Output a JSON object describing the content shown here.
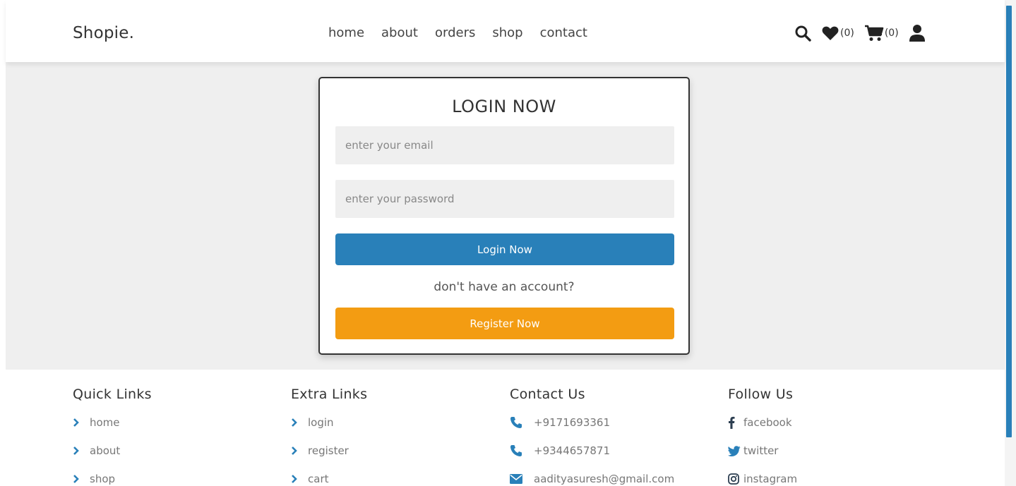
{
  "header": {
    "logo": "Shopie.",
    "nav": [
      {
        "label": "home"
      },
      {
        "label": "about"
      },
      {
        "label": "orders"
      },
      {
        "label": "shop"
      },
      {
        "label": "contact"
      }
    ],
    "wishlist_count": "(0)",
    "cart_count": "(0)"
  },
  "login_form": {
    "title": "LOGIN NOW",
    "email_placeholder": "enter your email",
    "password_placeholder": "enter your password",
    "login_button": "Login Now",
    "no_account_text": "don't have an account?",
    "register_button": "Register Now"
  },
  "footer": {
    "quick_links": {
      "title": "Quick Links",
      "items": [
        "home",
        "about",
        "shop"
      ]
    },
    "extra_links": {
      "title": "Extra Links",
      "items": [
        "login",
        "register",
        "cart"
      ]
    },
    "contact": {
      "title": "Contact Us",
      "items": [
        "+9171693361",
        "+9344657871",
        "aadityasuresh@gmail.com"
      ]
    },
    "follow": {
      "title": "Follow Us",
      "items": [
        "facebook",
        "twitter",
        "instagram"
      ]
    }
  },
  "colors": {
    "primary": "#2980b9",
    "accent": "#f39c12",
    "background": "#efefef",
    "text": "#333333"
  },
  "icons": {
    "header": [
      "search-icon",
      "heart-icon",
      "cart-icon",
      "user-icon"
    ],
    "footer_link": "chevron-right-icon",
    "contact": [
      "phone-icon",
      "phone-icon",
      "envelope-icon"
    ],
    "social": [
      "facebook-icon",
      "twitter-icon",
      "instagram-icon"
    ]
  }
}
